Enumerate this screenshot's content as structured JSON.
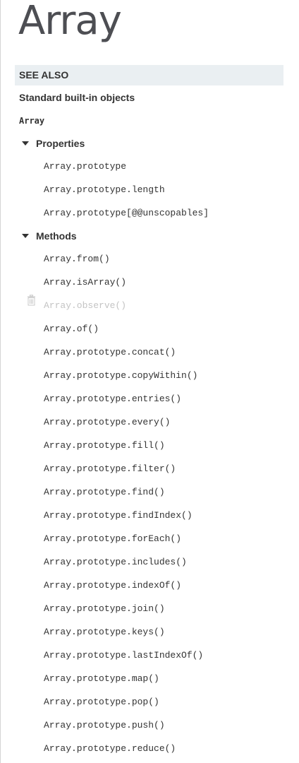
{
  "page": {
    "title": "Array"
  },
  "sidebar": {
    "see_also": "SEE ALSO",
    "standard_objects": "Standard built-in objects",
    "current": "Array",
    "properties_label": "Properties",
    "properties": [
      "Array.prototype",
      "Array.prototype.length",
      "Array.prototype[@@unscopables]"
    ],
    "methods_label": "Methods",
    "methods": [
      {
        "label": "Array.from()",
        "obsolete": false
      },
      {
        "label": "Array.isArray()",
        "obsolete": false
      },
      {
        "label": "Array.observe()",
        "obsolete": true,
        "icon": "trash-icon"
      },
      {
        "label": "Array.of()",
        "obsolete": false
      },
      {
        "label": "Array.prototype.concat()",
        "obsolete": false
      },
      {
        "label": "Array.prototype.copyWithin()",
        "obsolete": false
      },
      {
        "label": "Array.prototype.entries()",
        "obsolete": false
      },
      {
        "label": "Array.prototype.every()",
        "obsolete": false
      },
      {
        "label": "Array.prototype.fill()",
        "obsolete": false
      },
      {
        "label": "Array.prototype.filter()",
        "obsolete": false
      },
      {
        "label": "Array.prototype.find()",
        "obsolete": false
      },
      {
        "label": "Array.prototype.findIndex()",
        "obsolete": false
      },
      {
        "label": "Array.prototype.forEach()",
        "obsolete": false
      },
      {
        "label": "Array.prototype.includes()",
        "obsolete": false
      },
      {
        "label": "Array.prototype.indexOf()",
        "obsolete": false
      },
      {
        "label": "Array.prototype.join()",
        "obsolete": false
      },
      {
        "label": "Array.prototype.keys()",
        "obsolete": false
      },
      {
        "label": "Array.prototype.lastIndexOf()",
        "obsolete": false
      },
      {
        "label": "Array.prototype.map()",
        "obsolete": false
      },
      {
        "label": "Array.prototype.pop()",
        "obsolete": false
      },
      {
        "label": "Array.prototype.push()",
        "obsolete": false
      },
      {
        "label": "Array.prototype.reduce()",
        "obsolete": false
      }
    ]
  },
  "colors": {
    "see_also_bg": "#eaeff2",
    "text": "#333333",
    "obsolete_text": "#c4c4c4",
    "title": "#4d4e53"
  }
}
